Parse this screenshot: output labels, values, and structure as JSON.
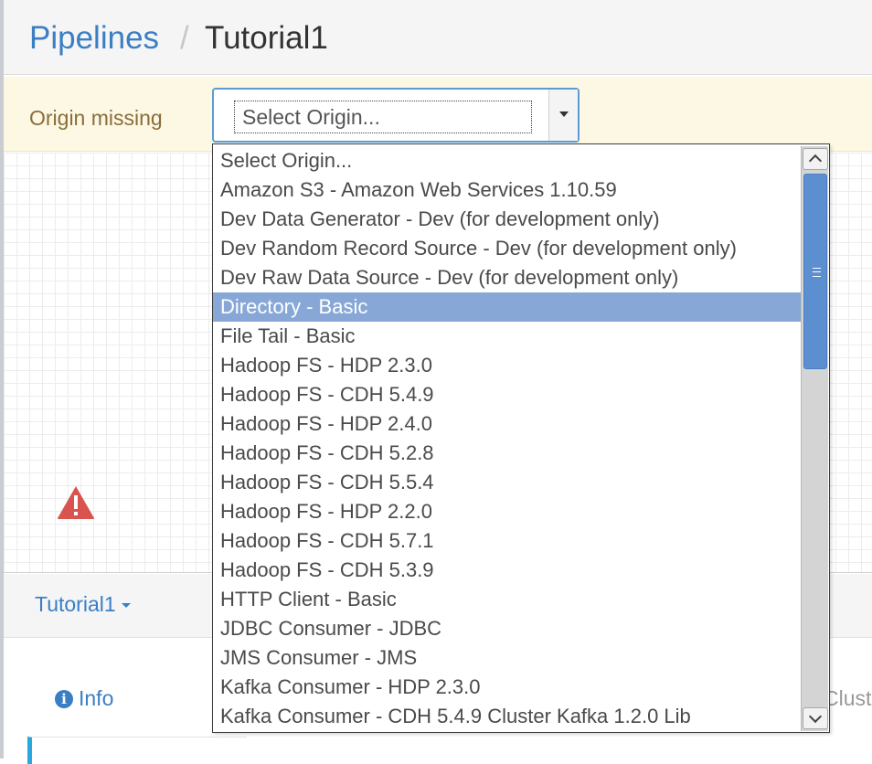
{
  "breadcrumb": {
    "root": "Pipelines",
    "separator": "/",
    "current": "Tutorial1"
  },
  "alert": {
    "message": "Origin missing",
    "select_value": "Select Origin..."
  },
  "origin_options": [
    "Select Origin...",
    "Amazon S3 - Amazon Web Services 1.10.59",
    "Dev Data Generator - Dev (for development only)",
    "Dev Random Record Source - Dev (for development only)",
    "Dev Raw Data Source - Dev (for development only)",
    "Directory - Basic",
    "File Tail - Basic",
    "Hadoop FS - HDP 2.3.0",
    "Hadoop FS - CDH 5.4.9",
    "Hadoop FS - HDP 2.4.0",
    "Hadoop FS - CDH 5.2.8",
    "Hadoop FS - CDH 5.5.4",
    "Hadoop FS - HDP 2.2.0",
    "Hadoop FS - CDH 5.7.1",
    "Hadoop FS - CDH 5.3.9",
    "HTTP Client - Basic",
    "JDBC Consumer - JDBC",
    "JMS Consumer - JMS",
    "Kafka Consumer - HDP 2.3.0",
    "Kafka Consumer - CDH 5.4.9 Cluster Kafka 1.2.0 Lib"
  ],
  "selected_option": "Directory - Basic",
  "bottom_panel": {
    "pipeline_name": "Tutorial1",
    "info_tab": "Info",
    "cluster_tab": "Cluster"
  },
  "icons": {
    "warning": "warning-triangle-icon",
    "info": "info-circle-icon",
    "dropdown_caret": "caret-down-icon"
  },
  "colors": {
    "link": "#3a7fc4",
    "alert_bg": "#fcf8e3",
    "alert_text": "#8a6d3b",
    "selected_option": "#87a8d7",
    "warning": "#d9534f"
  }
}
